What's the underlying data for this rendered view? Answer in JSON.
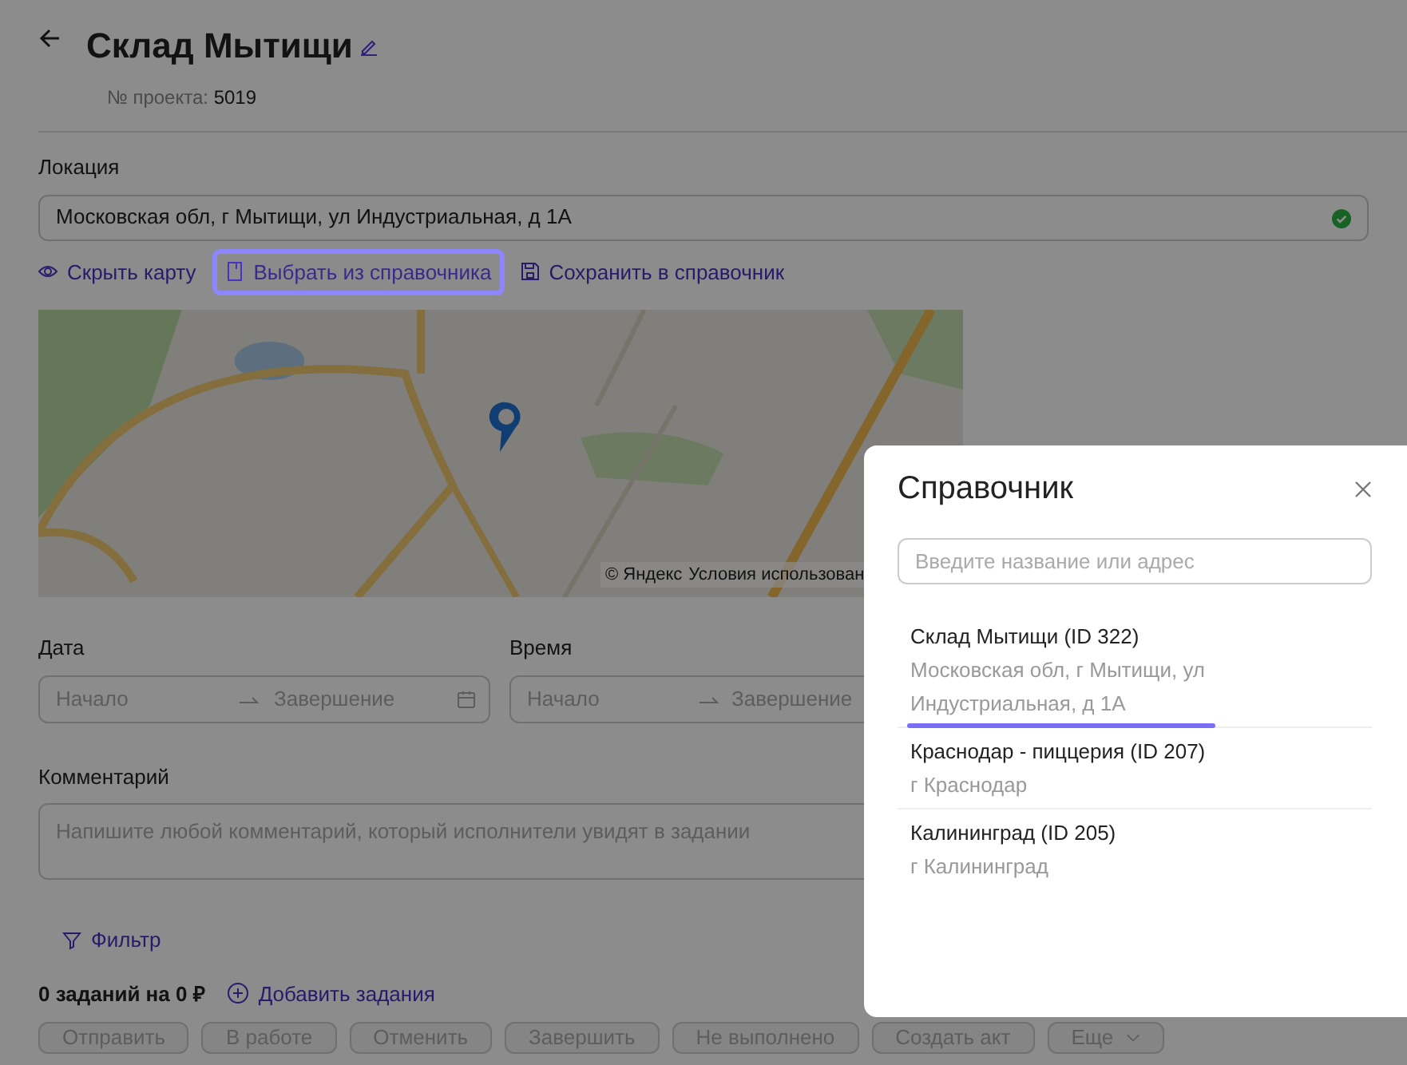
{
  "header": {
    "title": "Склад Мытищи",
    "project_label": "№ проекта:",
    "project_number": "5019"
  },
  "location": {
    "label": "Локация",
    "value": "Московская обл, г Мытищи, ул Индустриальная, д 1А",
    "valid": true,
    "actions": [
      {
        "label": "Скрыть карту",
        "kind": "eye",
        "focused": false
      },
      {
        "label": "Выбрать из справочника",
        "kind": "book",
        "focused": true
      },
      {
        "label": "Сохранить в справочник",
        "kind": "save",
        "focused": false
      }
    ],
    "map": {
      "kind": "picture",
      "attribution": "© Яндекс",
      "terms_link": "Условия использован"
    }
  },
  "date": {
    "label": "Дата",
    "start_placeholder": "Начало",
    "end_placeholder": "Завершение"
  },
  "time": {
    "label": "Время",
    "start_placeholder": "Начало",
    "end_placeholder": "Завершение"
  },
  "comment": {
    "label": "Комментарий",
    "placeholder": "Напишите любой комментарий, который исполнители увидят в задании"
  },
  "filter": {
    "label": "Фильтр"
  },
  "tasks": {
    "summary": "0 заданий на 0 ₽",
    "add_label": "Добавить задания"
  },
  "task_buttons": [
    {
      "label": "Отправить",
      "disabled": true
    },
    {
      "label": "В работе",
      "disabled": true
    },
    {
      "label": "Отменить",
      "disabled": true
    },
    {
      "label": "Завершить",
      "disabled": true
    },
    {
      "label": "Не выполнено",
      "disabled": true
    },
    {
      "label": "Создать акт",
      "disabled": true
    }
  ],
  "more_button": {
    "label": "Еще",
    "disabled": true
  },
  "modal": {
    "title": "Справочник",
    "search_placeholder": "Введите название или адрес",
    "items": [
      {
        "name": "Склад Мытищи (ID 322)",
        "address": "Московская обл, г Мытищи, ул Индустриальная, д 1А",
        "selected": true
      },
      {
        "name": "Краснодар - пиццерия (ID 207)",
        "address": "г Краснодар",
        "selected": false
      },
      {
        "name": "Калининград (ID 205)",
        "address": "г Калининград",
        "selected": false
      }
    ]
  }
}
